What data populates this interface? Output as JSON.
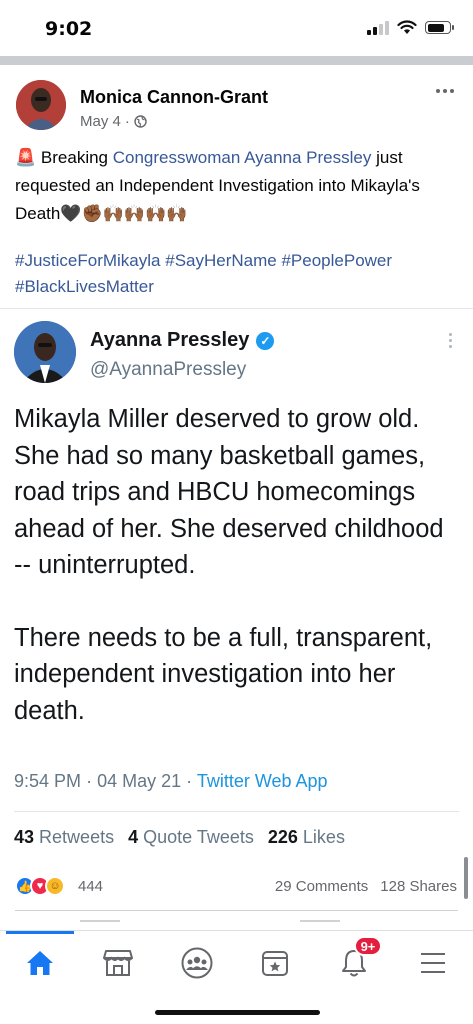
{
  "status_bar": {
    "time": "9:02"
  },
  "post": {
    "author": "Monica Cannon-Grant",
    "date": "May 4",
    "separator": "·",
    "text_prefix": "Breaking",
    "text_link": "Congresswoman Ayanna Pressley",
    "text_suffix": "just requested an Independent Investigation into Mikayla's Death",
    "emoji_tail": "🖤✊🏾🙌🏾🙌🏾🙌🏾🙌🏾",
    "alert_emoji": "🚨",
    "hashtags": [
      "#JusticeForMikayla",
      "#SayHerName",
      "#PeoplePower",
      "#BlackLivesMatter"
    ]
  },
  "tweet": {
    "name": "Ayanna Pressley",
    "handle": "@AyannaPressley",
    "paragraph_1": "Mikayla Miller deserved to grow old. She had so many basketball games, road trips and HBCU homecomings ahead of her. She deserved childhood -- uninterrupted.",
    "paragraph_2": "There needs to be a full, transparent, independent investigation into her death.",
    "time": "9:54 PM",
    "date": "04 May 21",
    "source": "Twitter Web App",
    "stats": {
      "retweets_count": "43",
      "retweets_label": "Retweets",
      "quotes_count": "4",
      "quotes_label": "Quote Tweets",
      "likes_count": "226",
      "likes_label": "Likes"
    }
  },
  "engagement": {
    "reactions_count": "444",
    "comments": "29 Comments",
    "shares": "128 Shares"
  },
  "bottom_nav": {
    "notifications_badge": "9+",
    "items": [
      "home-icon",
      "marketplace-icon",
      "groups-icon",
      "events-icon",
      "bell-icon",
      "menu-icon"
    ]
  },
  "colors": {
    "facebook_blue": "#1877f2",
    "link_blue": "#385898",
    "twitter_blue": "#1b95e0",
    "badge_red": "#e41e3f"
  }
}
